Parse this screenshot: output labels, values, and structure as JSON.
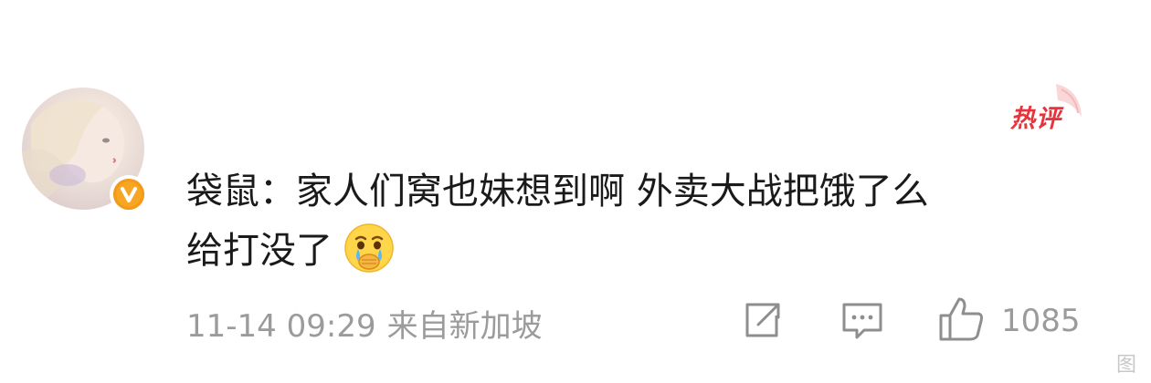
{
  "hot_tag": {
    "label": "热评",
    "color": "#e8323c"
  },
  "comment": {
    "author": "袋鼠",
    "separator": "：",
    "line1": "家人们窝也妹想到啊 外卖大战把饿了么",
    "line2": "给打没了",
    "emoji": "crying-face-emoji"
  },
  "meta": {
    "time": "11-14 09:29",
    "location": "来自新加坡"
  },
  "actions": {
    "like_count": "1085"
  },
  "colors": {
    "badge": "#f6a623",
    "meta_text": "#9b9b9b"
  },
  "watermark": "图"
}
